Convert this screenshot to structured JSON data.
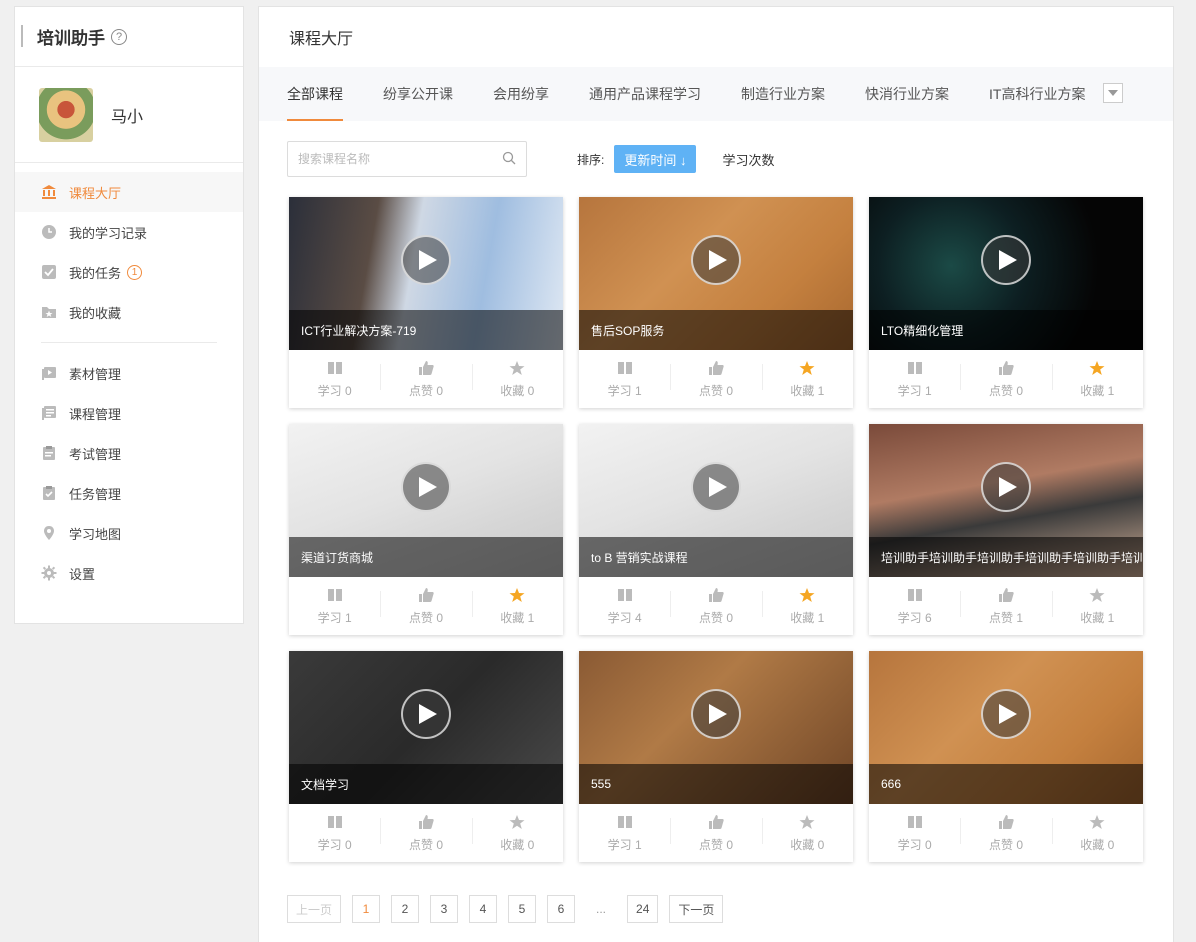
{
  "sidebar": {
    "title": "培训助手",
    "help_icon": "?",
    "user": {
      "name": "马小"
    },
    "menu_group1": [
      {
        "label": "课程大厅",
        "icon": "bank-icon",
        "active": true
      },
      {
        "label": "我的学习记录",
        "icon": "clock-icon",
        "active": false
      },
      {
        "label": "我的任务",
        "icon": "checkbox-icon",
        "active": false,
        "badge": "1"
      },
      {
        "label": "我的收藏",
        "icon": "folder-star-icon",
        "active": false
      }
    ],
    "menu_group2": [
      {
        "label": "素材管理",
        "icon": "media-icon"
      },
      {
        "label": "课程管理",
        "icon": "course-icon"
      },
      {
        "label": "考试管理",
        "icon": "exam-icon"
      },
      {
        "label": "任务管理",
        "icon": "task-icon"
      },
      {
        "label": "学习地图",
        "icon": "map-pin-icon"
      },
      {
        "label": "设置",
        "icon": "gear-icon"
      }
    ]
  },
  "main": {
    "title": "课程大厅",
    "tabs": [
      "全部课程",
      "纷享公开课",
      "会用纷享",
      "通用产品课程学习",
      "制造行业方案",
      "快消行业方案",
      "IT高科行业方案"
    ],
    "active_tab": 0,
    "search": {
      "placeholder": "搜索课程名称",
      "value": ""
    },
    "sort": {
      "label": "排序:",
      "active": "更新时间 ↓",
      "other": "学习次数"
    },
    "stat_labels": {
      "study": "学习",
      "like": "点赞",
      "fav": "收藏"
    },
    "courses": [
      {
        "title": "ICT行业解决方案-719",
        "study": 0,
        "like": 0,
        "fav": 0,
        "starred": false,
        "theme": "business"
      },
      {
        "title": "售后SOP服务",
        "study": 1,
        "like": 0,
        "fav": 1,
        "starred": true,
        "theme": "desk"
      },
      {
        "title": "LTO精细化管理",
        "study": 1,
        "like": 0,
        "fav": 1,
        "starred": true,
        "theme": "dark"
      },
      {
        "title": "渠道订货商城",
        "study": 1,
        "like": 0,
        "fav": 1,
        "starred": true,
        "theme": "blueprint"
      },
      {
        "title": "to B 营销实战课程",
        "study": 4,
        "like": 0,
        "fav": 1,
        "starred": true,
        "theme": "blueprint"
      },
      {
        "title": "培训助手培训助手培训助手培训助手培训助手培训助手",
        "study": 6,
        "like": 1,
        "fav": 1,
        "starred": false,
        "theme": "graduation"
      },
      {
        "title": "文档学习",
        "study": 0,
        "like": 0,
        "fav": 0,
        "starred": false,
        "theme": "laptopdark"
      },
      {
        "title": "555",
        "study": 1,
        "like": 0,
        "fav": 0,
        "starred": false,
        "theme": "laptopwood"
      },
      {
        "title": "666",
        "study": 0,
        "like": 0,
        "fav": 0,
        "starred": false,
        "theme": "desk"
      }
    ],
    "pager": {
      "prev": "上一页",
      "pages": [
        "1",
        "2",
        "3",
        "4",
        "5",
        "6"
      ],
      "ellipsis": "...",
      "last": "24",
      "next": "下一页",
      "current": "1"
    }
  },
  "colors": {
    "accent": "#f08a3c",
    "sort_active": "#5fb2f5",
    "star": "#f5a623"
  }
}
